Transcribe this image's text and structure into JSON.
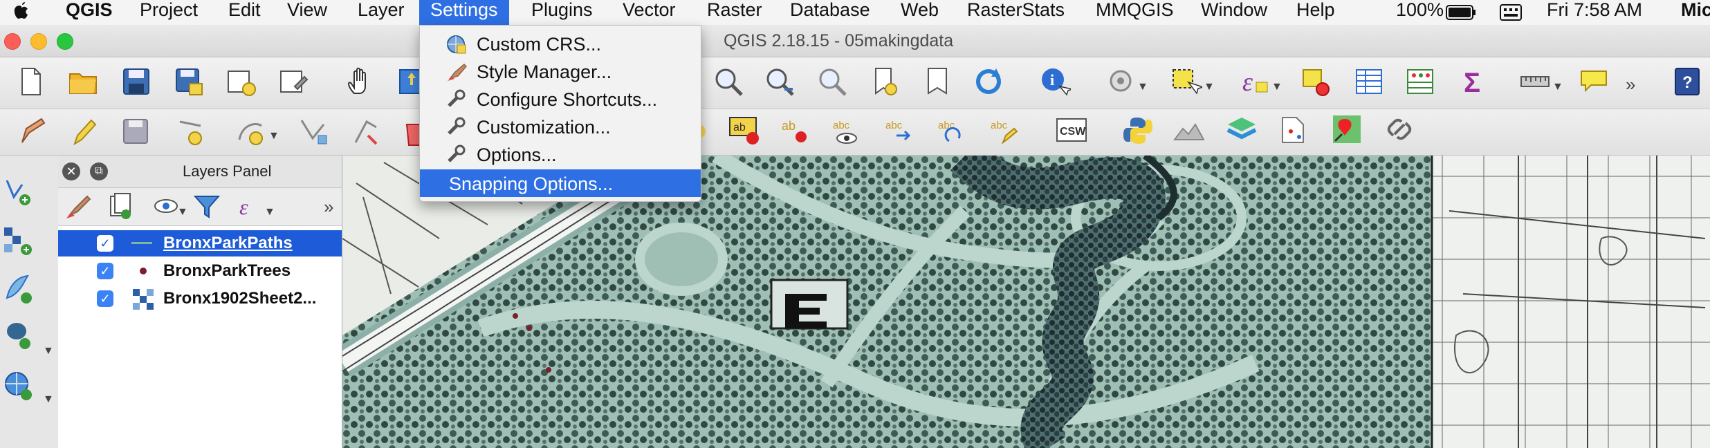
{
  "menubar": {
    "app_name": "QGIS",
    "items": [
      "Project",
      "Edit",
      "View",
      "Layer",
      "Settings",
      "Plugins",
      "Vector",
      "Raster",
      "Database",
      "Web",
      "RasterStats",
      "MMQGIS",
      "Window",
      "Help"
    ],
    "battery": "100%",
    "clock": "Fri 7:58 AM",
    "user": "Mic"
  },
  "window": {
    "title": "QGIS 2.18.15 - 05makingdata"
  },
  "settings_menu": {
    "items": [
      {
        "label": "Custom CRS...",
        "icon": "crs-globe-icon"
      },
      {
        "label": "Style Manager...",
        "icon": "style-brush-icon"
      },
      {
        "label": "Configure Shortcuts...",
        "icon": "wrench-icon"
      },
      {
        "label": "Customization...",
        "icon": "wrench-icon"
      },
      {
        "label": "Options...",
        "icon": "wrench-icon"
      },
      {
        "label": "Snapping Options...",
        "icon": "",
        "highlighted": true
      }
    ]
  },
  "layers_panel": {
    "title": "Layers Panel",
    "layers": [
      {
        "name": "BronxParkPaths",
        "checked": true,
        "selected": true,
        "symbol": "line"
      },
      {
        "name": "BronxParkTrees",
        "checked": true,
        "selected": false,
        "symbol": "point"
      },
      {
        "name": "Bronx1902Sheet2...",
        "checked": true,
        "selected": false,
        "symbol": "raster"
      }
    ]
  },
  "toolbar2": {
    "csw_label": "CSW"
  },
  "colors": {
    "menu_highlight": "#2f6fe4",
    "layer_selected": "#1d5bd8",
    "map_base": "#a9c6bd"
  }
}
